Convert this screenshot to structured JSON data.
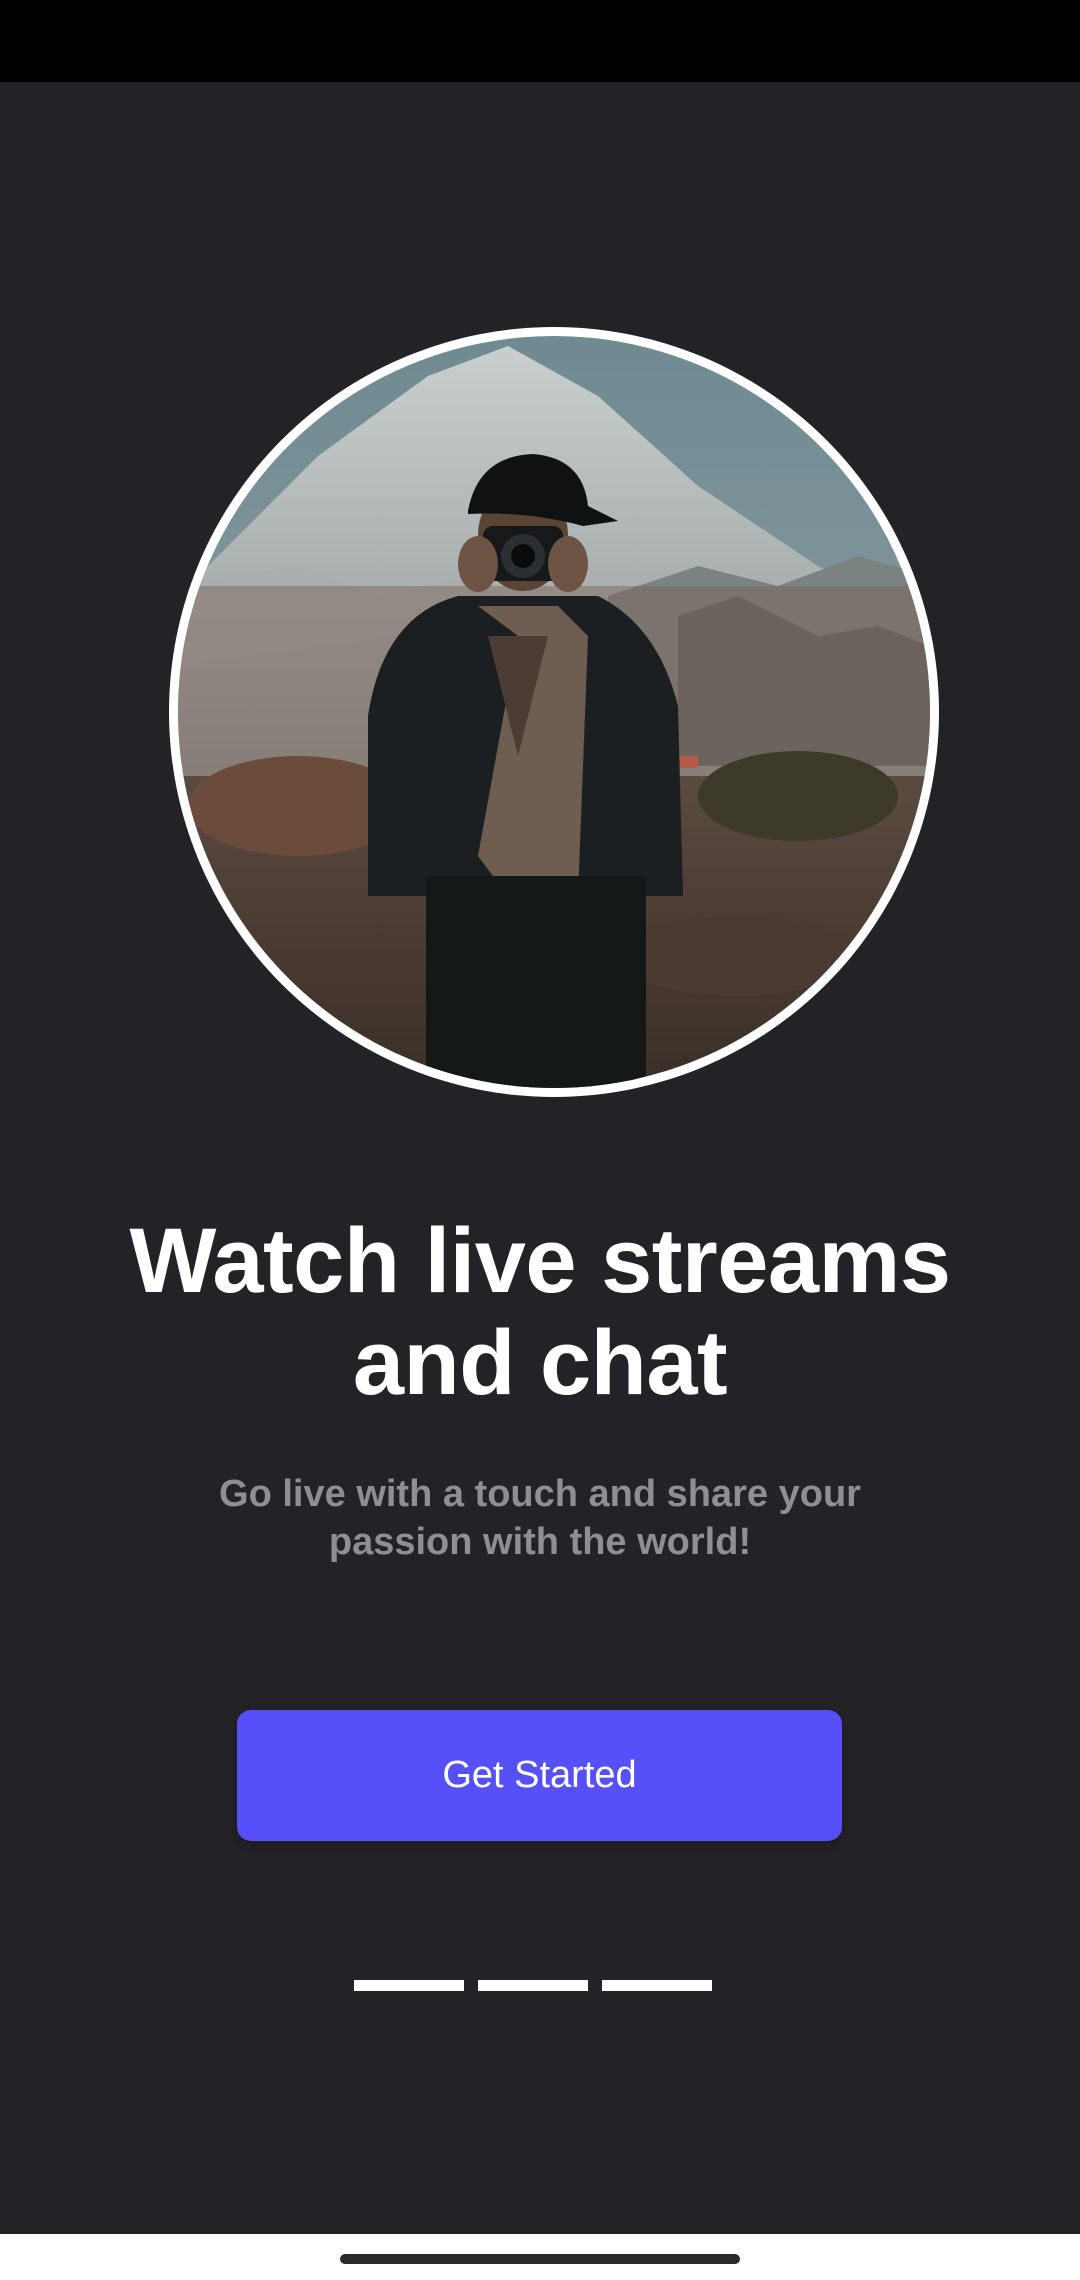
{
  "onboarding": {
    "title_line1": "Watch live streams",
    "title_line2": "and chat",
    "subtitle_line1": "Go live with a touch and share your",
    "subtitle_line2": "passion with the world!",
    "cta_label": "Get Started",
    "pages_total": 3
  },
  "colors": {
    "background": "#232227",
    "accent": "#5650fb",
    "subtitle": "#8f8e94"
  }
}
